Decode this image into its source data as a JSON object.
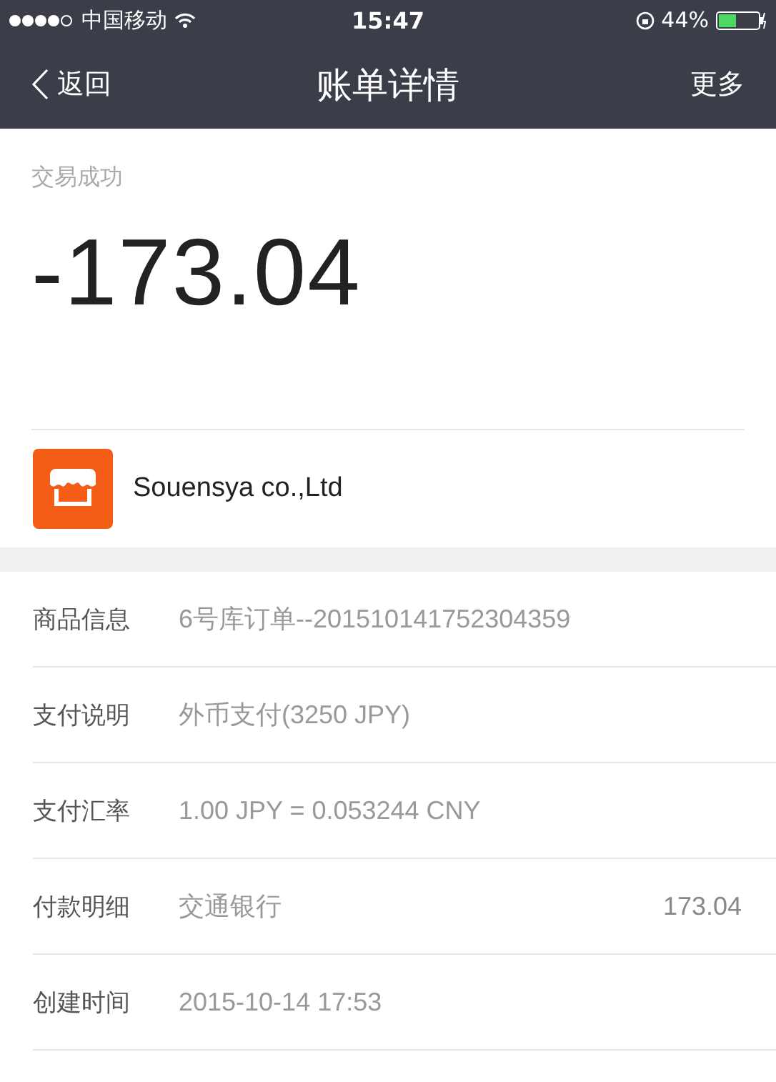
{
  "status_bar": {
    "carrier": "中国移动",
    "time": "15:47",
    "battery": "44%"
  },
  "nav_bar": {
    "back": "返回",
    "title": "账单详情",
    "more": "更多"
  },
  "transaction": {
    "status": "交易成功",
    "amount": "-173.04"
  },
  "merchant": {
    "name": "Souensya co.,Ltd"
  },
  "details": [
    {
      "label": "商品信息",
      "value": "6号库订单--201510141752304359"
    },
    {
      "label": "支付说明",
      "value": "外币支付(3250 JPY)"
    },
    {
      "label": "支付汇率",
      "value": "1.00 JPY = 0.053244 CNY"
    },
    {
      "label": "付款明细",
      "value": "交通银行",
      "amount": "173.04"
    },
    {
      "label": "创建时间",
      "value": "2015-10-14 17:53"
    }
  ]
}
